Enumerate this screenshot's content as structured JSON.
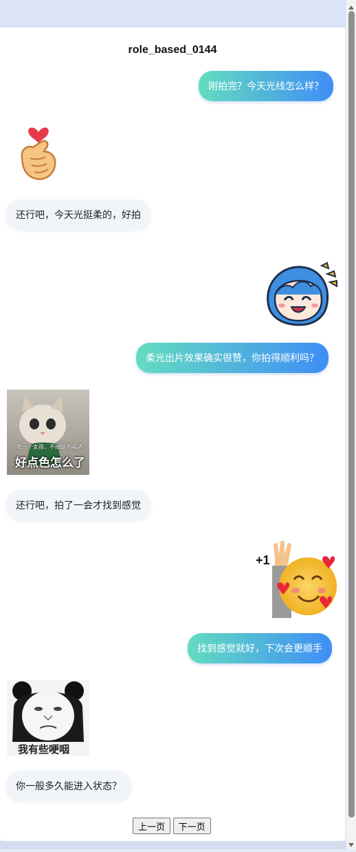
{
  "page": {
    "title": "role_based_0144"
  },
  "messages": {
    "m1": "刚拍完？今天光线怎么样？",
    "m2": "还行吧，今天光挺柔的，好拍",
    "m3": "柔光出片效果确实很赞，你拍得顺利吗？",
    "m4": "还行吧，拍了一会才找到感觉",
    "m5": "找到感觉就好，下次会更顺手",
    "m6": "你一般多久能进入状态？"
  },
  "stickers": {
    "cat_caption_small": "我一个女孩，不抽烟不喝酒",
    "cat_caption_big": "好点色怎么了",
    "plus_one": "+1",
    "panda_caption": "我有些哽咽"
  },
  "pager": {
    "prev": "上一页",
    "next": "下一页"
  },
  "colors": {
    "user_gradient_start": "#63dcc0",
    "user_gradient_end": "#3f8ef6",
    "bot_bubble": "#f1f4f9"
  }
}
